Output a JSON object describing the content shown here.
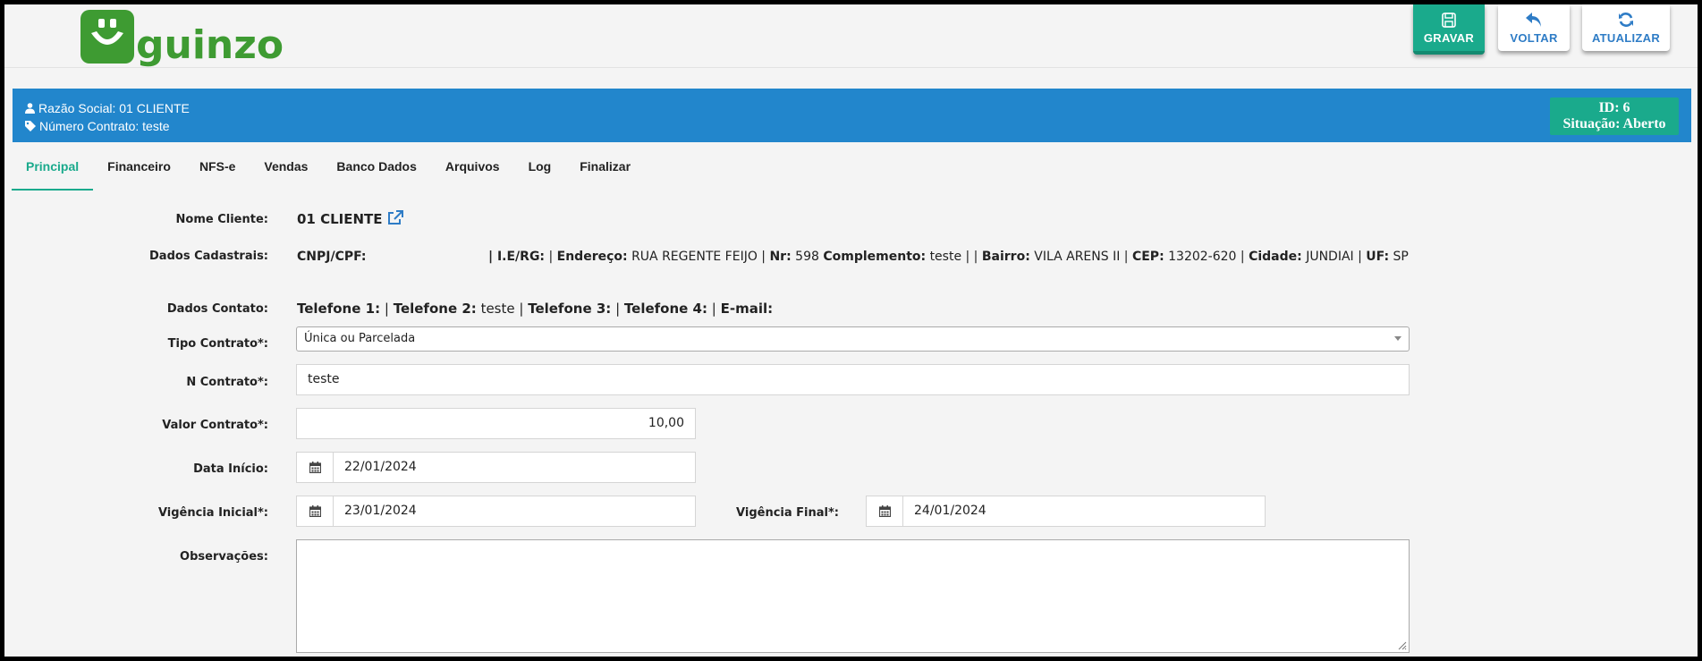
{
  "logo": {
    "text": "guinzo"
  },
  "toolbar": {
    "save_label": "GRAVAR",
    "back_label": "VOLTAR",
    "refresh_label": "ATUALIZAR"
  },
  "banner": {
    "razao_social": "Razão Social: 01 CLIENTE",
    "numero_contrato": "Número Contrato: teste",
    "id": "ID: 6",
    "situacao": "Situação: Aberto"
  },
  "tabs": [
    "Principal",
    "Financeiro",
    "NFS-e",
    "Vendas",
    "Banco Dados",
    "Arquivos",
    "Log",
    "Finalizar"
  ],
  "form": {
    "nome_cliente": {
      "label": "Nome Cliente:",
      "value": "01 CLIENTE"
    },
    "dados_cadastrais": {
      "label": "Dados Cadastrais:",
      "cnpj_label": "CNPJ/CPF:",
      "ie_label": "| I.E/RG:",
      "sep1": "|",
      "endereco_label": "Endereço:",
      "endereco": "RUA REGENTE FEIJO",
      "sep2": "|",
      "nr_label": "Nr:",
      "nr": "598",
      "complemento_label": "Complemento:",
      "complemento": "teste | |",
      "bairro_label": "Bairro:",
      "bairro": "VILA ARENS II |",
      "cep_label": "CEP:",
      "cep": "13202-620 |",
      "cidade_label": "Cidade:",
      "cidade": "JUNDIAI |",
      "uf_label": "UF:",
      "uf": "SP"
    },
    "dados_contato": {
      "label": "Dados Contato:",
      "tel1_label": "Telefone 1:",
      "sep1": "|",
      "tel2_label": "Telefone 2:",
      "tel2": "teste |",
      "tel3_label": "Telefone 3:",
      "sep3": "|",
      "tel4_label": "Telefone 4:",
      "sep4": "|",
      "email_label": "E-mail:"
    },
    "tipo_contrato": {
      "label": "Tipo Contrato*:",
      "value": "Única ou Parcelada"
    },
    "n_contrato": {
      "label": "N Contrato*:",
      "value": "teste"
    },
    "valor_contrato": {
      "label": "Valor Contrato*:",
      "value": "10,00"
    },
    "data_inicio": {
      "label": "Data Início:",
      "value": "22/01/2024"
    },
    "vigencia_inicial": {
      "label": "Vigência Inicial*:",
      "value": "23/01/2024"
    },
    "vigencia_final": {
      "label": "Vigência Final*:",
      "value": "24/01/2024"
    },
    "observacoes": {
      "label": "Observações:",
      "value": ""
    }
  },
  "colors": {
    "brand_green": "#3e9b32",
    "teal": "#1aaa8c",
    "banner_blue": "#2286cc",
    "link_blue": "#2e7cc6"
  },
  "icons": [
    "save-icon",
    "reply-icon",
    "refresh-icon",
    "user-icon",
    "tag-icon",
    "external-link-icon",
    "calendar-icon"
  ]
}
